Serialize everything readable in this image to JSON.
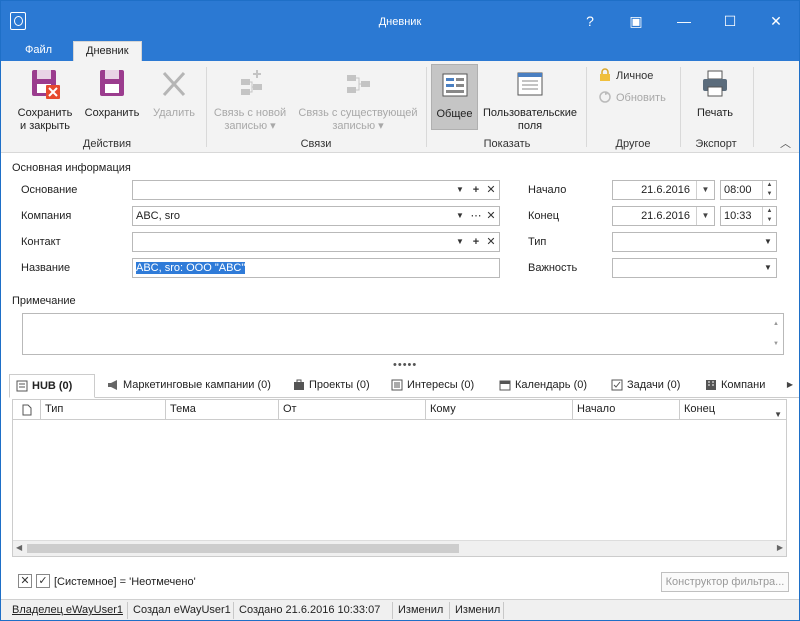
{
  "window": {
    "title": "Дневник",
    "help": "?",
    "restore_extra": "▣",
    "minimize": "—",
    "maximize": "☐",
    "close": "✕"
  },
  "ribbon_tabs": [
    "Файл",
    "Дневник"
  ],
  "ribbon": {
    "save_close": [
      "Сохранить",
      "и закрыть"
    ],
    "save": "Сохранить",
    "delete": "Удалить",
    "group_actions": "Действия",
    "link_new": [
      "Связь с новой",
      "записью ▾"
    ],
    "link_existing": [
      "Связь с существующей",
      "записью ▾"
    ],
    "group_links": "Связи",
    "general": "Общее",
    "user_fields": [
      "Пользовательские",
      "поля"
    ],
    "group_show": "Показать",
    "personal": "Личное",
    "refresh": "Обновить",
    "group_other": "Другое",
    "print": "Печать",
    "group_export": "Экспорт",
    "collapse": "︿"
  },
  "form": {
    "section_title": "Основная информация",
    "basis_label": "Основание",
    "basis_value": "",
    "company_label": "Компания",
    "company_value": "ABC, sro",
    "contact_label": "Контакт",
    "contact_value": "",
    "name_label": "Название",
    "name_value": "ABC, sro: ООО \"ABC\"",
    "start_label": "Начало",
    "start_date": "21.6.2016",
    "start_time": "08:00",
    "end_label": "Конец",
    "end_date": "21.6.2016",
    "end_time": "10:33",
    "type_label": "Тип",
    "type_value": "",
    "importance_label": "Важность",
    "importance_value": "",
    "note_label": "Примечание",
    "note_value": ""
  },
  "splitter": "•••••",
  "tabs": [
    {
      "label": "HUB (0)",
      "icon": "hub-icon"
    },
    {
      "label": "Маркетинговые кампании (0)",
      "icon": "megaphone-icon"
    },
    {
      "label": "Проекты (0)",
      "icon": "projects-icon"
    },
    {
      "label": "Интересы (0)",
      "icon": "interests-icon"
    },
    {
      "label": "Календарь (0)",
      "icon": "calendar-icon"
    },
    {
      "label": "Задачи (0)",
      "icon": "tasks-icon"
    },
    {
      "label": "Компани",
      "icon": "company-icon"
    }
  ],
  "grid": {
    "columns": [
      "Тип",
      "Тема",
      "От",
      "Кому",
      "Начало",
      "Конец"
    ],
    "rows": []
  },
  "filter": {
    "text": "[Системное] = 'Неотмечено'",
    "builder_button": "Конструктор фильтра..."
  },
  "status": {
    "owner": "Владелец eWayUser1",
    "created_by": "Создал eWayUser1",
    "created": "Создано 21.6.2016 10:33:07",
    "changed1": "Изменил",
    "changed2": "Изменил"
  }
}
